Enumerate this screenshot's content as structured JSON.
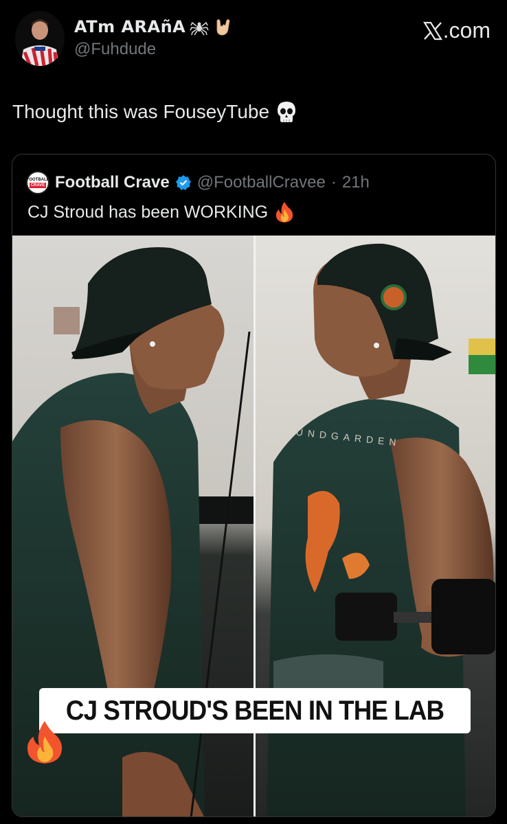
{
  "header": {
    "display_name": "ATm ARAñA",
    "display_name_emojis": [
      "spider-icon",
      "rock-hand-icon"
    ],
    "handle": "@Fuhdude",
    "brand": ".com",
    "brand_logo": "X"
  },
  "tweet": {
    "text": "Thought this was FouseyTube",
    "emoji": "skull-icon"
  },
  "quote": {
    "avatar_top": "FOOTBALL",
    "avatar_bottom": "CRAVE",
    "name": "Football Crave",
    "handle": "@FootballCravee",
    "separator": "·",
    "time": "21h",
    "text": "CJ Stroud has been WORKING",
    "emoji": "fire-icon",
    "image_caption": "CJ STROUD'S BEEN IN THE LAB",
    "shirt_text": "UNDGARDEN"
  },
  "colors": {
    "background": "#000000",
    "text": "#e7e9ea",
    "secondary": "#71767b",
    "border": "#333639",
    "verified": "#1d9bf0"
  }
}
